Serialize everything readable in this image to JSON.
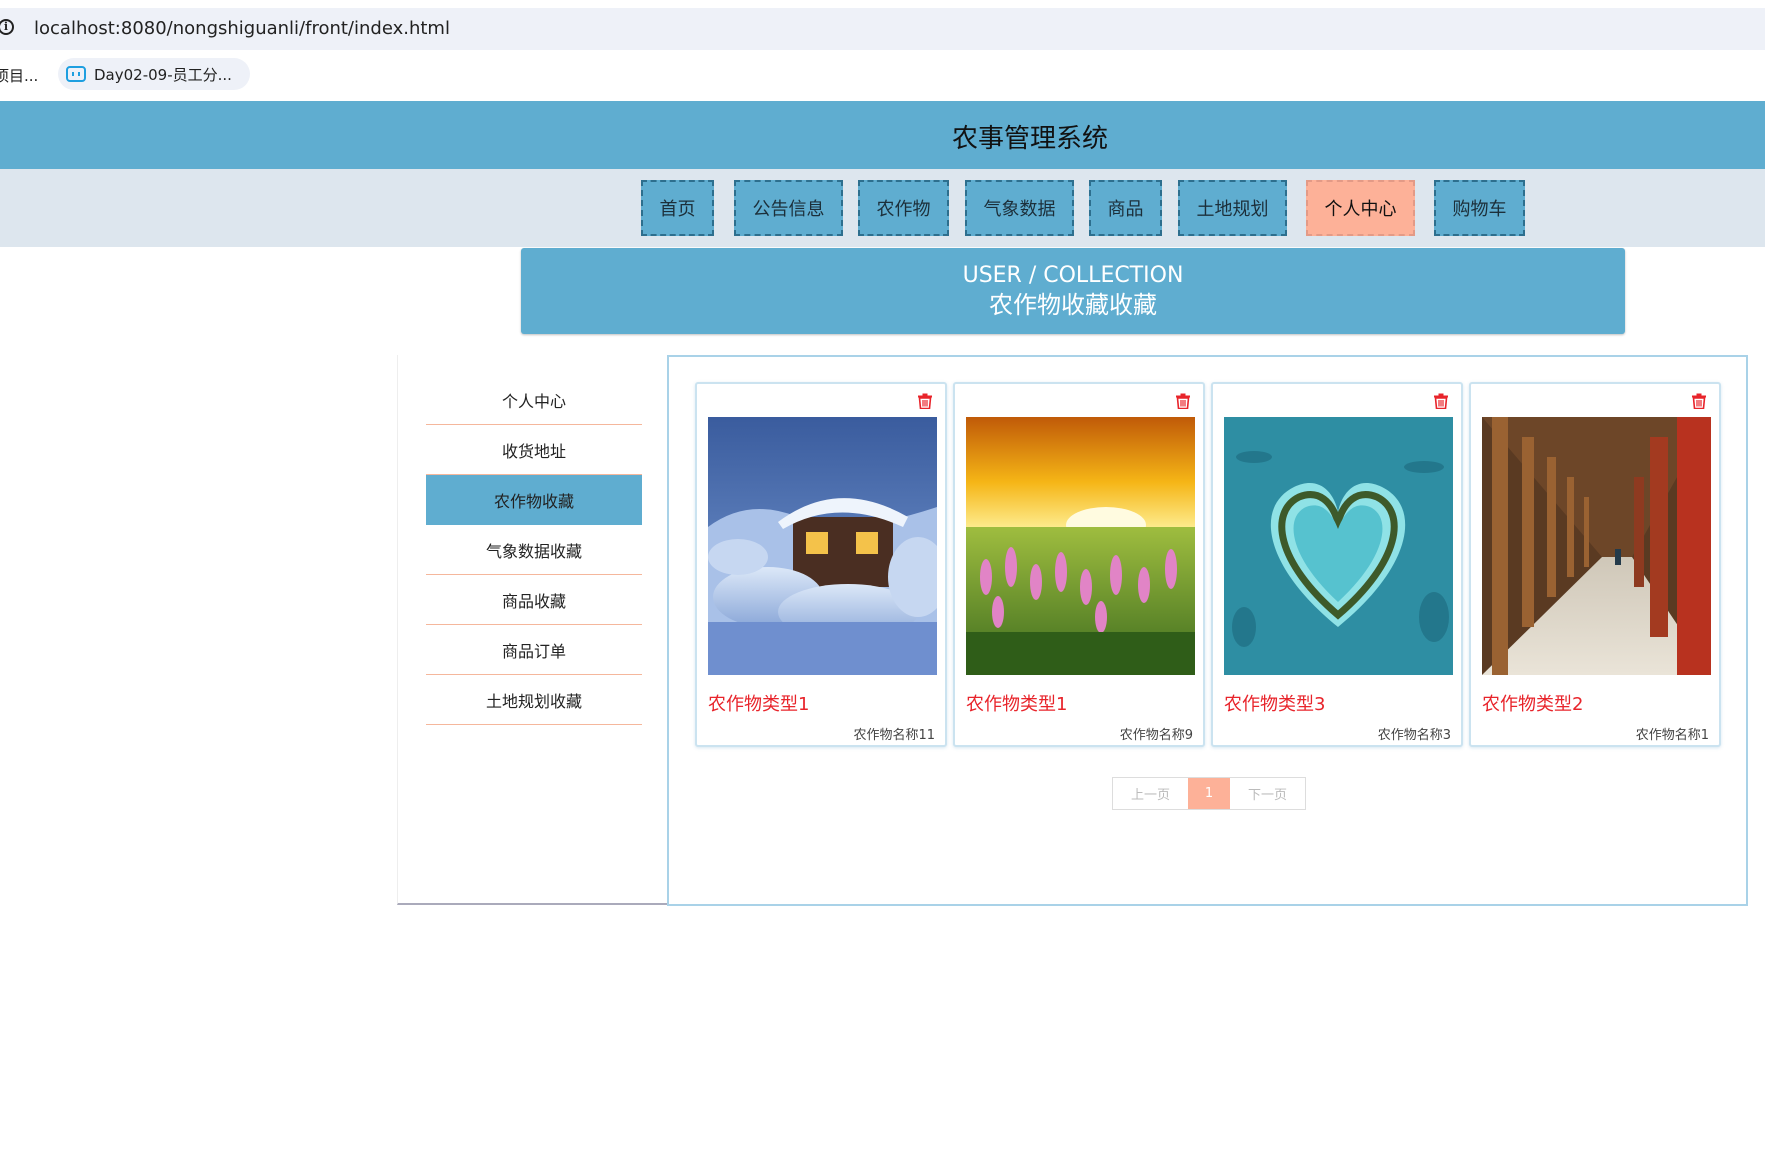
{
  "browser": {
    "url": "localhost:8080/nongshiguanli/front/index.html",
    "bookmarks": [
      {
        "label": "项目..."
      },
      {
        "label": "Day02-09-员工分..."
      }
    ]
  },
  "site": {
    "title": "农事管理系统"
  },
  "nav": {
    "items": [
      {
        "label": "首页"
      },
      {
        "label": "公告信息"
      },
      {
        "label": "农作物"
      },
      {
        "label": "气象数据"
      },
      {
        "label": "商品"
      },
      {
        "label": "土地规划"
      },
      {
        "label": "个人中心"
      },
      {
        "label": "购物车"
      }
    ],
    "active": "个人中心"
  },
  "banner": {
    "en": "USER / COLLECTION",
    "cn": "农作物收藏收藏"
  },
  "sidebar": {
    "items": [
      {
        "label": "个人中心"
      },
      {
        "label": "收货地址"
      },
      {
        "label": "农作物收藏"
      },
      {
        "label": "气象数据收藏"
      },
      {
        "label": "商品收藏"
      },
      {
        "label": "商品订单"
      },
      {
        "label": "土地规划收藏"
      }
    ],
    "active": "农作物收藏"
  },
  "cards": [
    {
      "type": "农作物类型1",
      "name": "农作物名称11",
      "image": "snow-village"
    },
    {
      "type": "农作物类型1",
      "name": "农作物名称9",
      "image": "sunset-flower-field"
    },
    {
      "type": "农作物类型3",
      "name": "农作物名称3",
      "image": "heart-island"
    },
    {
      "type": "农作物类型2",
      "name": "农作物名称1",
      "image": "temple-corridor"
    }
  ],
  "pagination": {
    "prev": "上一页",
    "current": "1",
    "next": "下一页"
  },
  "colors": {
    "primary": "#5fadd0",
    "accent": "#fdb198",
    "danger": "#e8242b"
  }
}
